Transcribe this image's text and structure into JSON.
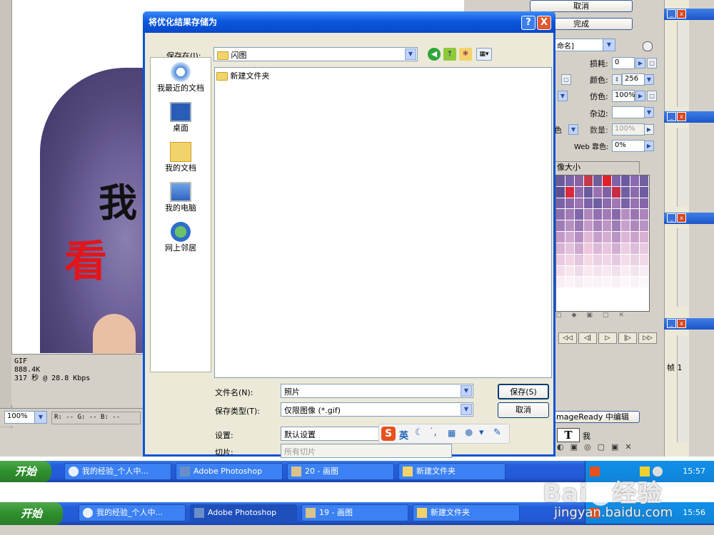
{
  "photoshop": {
    "status": {
      "format": "GIF",
      "size": "888.4K",
      "time": "317 秒 @ 28.8 Kbps"
    },
    "zoom": "100%",
    "rgb": "R: -- G: -- B: --",
    "canvas_chars": {
      "wo": "我",
      "kan": "看"
    }
  },
  "right_panel": {
    "cancel": "取消",
    "done": "完成",
    "preset": "命名]",
    "loss_label": "损耗:",
    "loss_value": "0",
    "colors_label": "颜色:",
    "colors_value": "256",
    "dither_label": "仿色:",
    "dither_value": "100%",
    "matte_label": "杂边:",
    "amount_label": "数量:",
    "amount_value": "100%",
    "web_label": "Web 靠色:",
    "web_value": "0%",
    "left_fragment_1": "色",
    "table_tab": "像大小",
    "imageready": "mageReady 中编辑",
    "frame_label": "帧 1",
    "type_char": "我",
    "anim_buttons": [
      "◁◁",
      "◁|",
      "▷",
      "|▷",
      "▷▷"
    ],
    "palette_colors": [
      "#6b5a9c",
      "#7a63a8",
      "#8a62a0",
      "#c23a4a",
      "#6e5c9c",
      "#e0202a",
      "#7c62a8",
      "#6b5aa0",
      "#8a6ab0",
      "#7060a0",
      "#5d4e92",
      "#d8283a",
      "#8e6cab",
      "#6a5b9d",
      "#9a70ae",
      "#8062a4",
      "#c72e44",
      "#705fa3",
      "#8c6aac",
      "#6c5ca0",
      "#7b62a8",
      "#8a68ac",
      "#9c74b2",
      "#7d64a8",
      "#6f5ea2",
      "#8d6bac",
      "#a079b4",
      "#7a63a8",
      "#9872b1",
      "#8566aa",
      "#8e6fae",
      "#a27ab5",
      "#7f66aa",
      "#b087bd",
      "#9270b0",
      "#a37bb6",
      "#8768ab",
      "#b58ec0",
      "#9a75b2",
      "#ad86bb",
      "#a07cb6",
      "#b690c1",
      "#9978b3",
      "#c39bc8",
      "#a883b9",
      "#bb95c4",
      "#9e7cb5",
      "#c7a2cb",
      "#ae89bc",
      "#b893c3",
      "#c29ac7",
      "#d0aad0",
      "#b690c2",
      "#e1b8d5",
      "#c79fcb",
      "#d4aed2",
      "#b994c4",
      "#dbb6d7",
      "#c9a3cc",
      "#d6b1d4",
      "#d8b3d6",
      "#e4c1dc",
      "#cfa9d0",
      "#f0c7dc",
      "#dcb8d8",
      "#e7c6de",
      "#d1aed2",
      "#eccde2",
      "#dcbcda",
      "#e8c9e0",
      "#e9cae1",
      "#f2d4e5",
      "#e2c5de",
      "#f6d9e7",
      "#ecd0e3",
      "#f0d6e6",
      "#e4c9e0",
      "#f4dcea",
      "#ead1e4",
      "#f1d9e8",
      "#f3dcea",
      "#f8e6ef",
      "#eedbe9",
      "#fae8f0",
      "#f4e2ee",
      "#f7e8f2",
      "#efe0ec",
      "#f9ecf4",
      "#f3e5f0",
      "#f8ecf4",
      "#f9eef4",
      "#fcf2f6",
      "#f6eef5",
      "#fdf3f7",
      "#f9f2f7",
      "#fbf4f8",
      "#f7f0f6",
      "#fcf6fa",
      "#f9f3f8",
      "#fcf7fa",
      "#ffffff",
      "#ffffff",
      "#ffffff",
      "#ffffff",
      "#ffffff",
      "#ffffff",
      "#ffffff",
      "#ffffff",
      "#ffffff",
      "#ffffff",
      "#ffffff",
      "#ffffff",
      "#ffffff",
      "#ffffff",
      "#ffffff",
      "#ffffff",
      "#ffffff",
      "#ffffff",
      "#ffffff",
      "#ffffff"
    ]
  },
  "dialog": {
    "title": "将优化结果存储为",
    "help": "?",
    "close": "X",
    "save_in_label": "保存在(I):",
    "save_in_value": "闪图",
    "places": [
      "我最近的文档",
      "桌面",
      "我的文档",
      "我的电脑",
      "网上邻居"
    ],
    "files": [
      "新建文件夹"
    ],
    "filename_label": "文件名(N):",
    "filename_value": "照片",
    "filetype_label": "保存类型(T):",
    "filetype_value": "仅限图像 (*.gif)",
    "settings_label": "设置:",
    "settings_value": "默认设置",
    "slices_label": "切片:",
    "slices_value": "所有切片",
    "save_button": "保存(S)",
    "cancel_button": "取消"
  },
  "ime": {
    "lang": "英"
  },
  "taskbar_top": {
    "start": "开始",
    "tasks": [
      "我的经验_个人中...",
      "Adobe Photoshop",
      "20 - 画图",
      "新建文件夹"
    ],
    "time": "15:57"
  },
  "taskbar_bottom": {
    "start": "开始",
    "tasks": [
      "我的经验_个人中...",
      "Adobe Photoshop",
      "19 - 画图",
      "新建文件夹"
    ],
    "time": "15:56"
  },
  "watermark": {
    "brand": "Bai",
    "brand2": "经验",
    "url": "jingyan.baidu.com"
  },
  "colors": {
    "xp_blue": "#0a53d8",
    "start_green": "#2e8f2d",
    "accent_red": "#e0161b"
  }
}
